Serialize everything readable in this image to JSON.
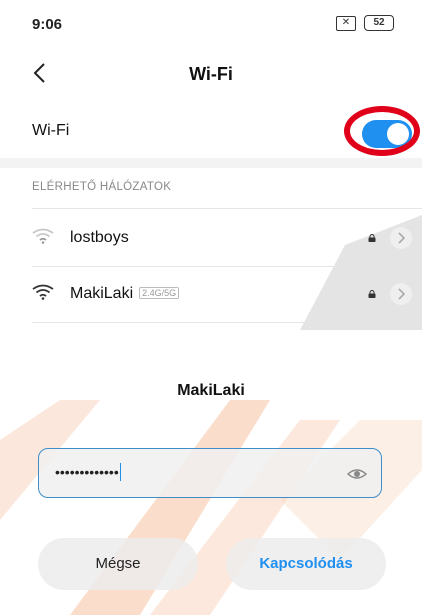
{
  "status_bar": {
    "time": "9:06",
    "sim_label": "✕",
    "battery": "52"
  },
  "header": {
    "title": "Wi-Fi"
  },
  "wifi_toggle": {
    "label": "Wi-Fi",
    "state": "on",
    "accent": "#1f8ff0"
  },
  "networks_section": {
    "label": "ELÉRHETŐ HÁLÓZATOK",
    "items": [
      {
        "name": "lostboys",
        "band": "",
        "locked": true,
        "signal": "weak"
      },
      {
        "name": "MakiLaki",
        "band": "2.4G/5G",
        "locked": true,
        "signal": "strong"
      }
    ]
  },
  "dialog": {
    "title": "MakiLaki",
    "password_value": "•••••••••••••",
    "cancel_label": "Mégse",
    "connect_label": "Kapcsolódás"
  },
  "annotation": {
    "highlight_color": "#e1001a"
  }
}
